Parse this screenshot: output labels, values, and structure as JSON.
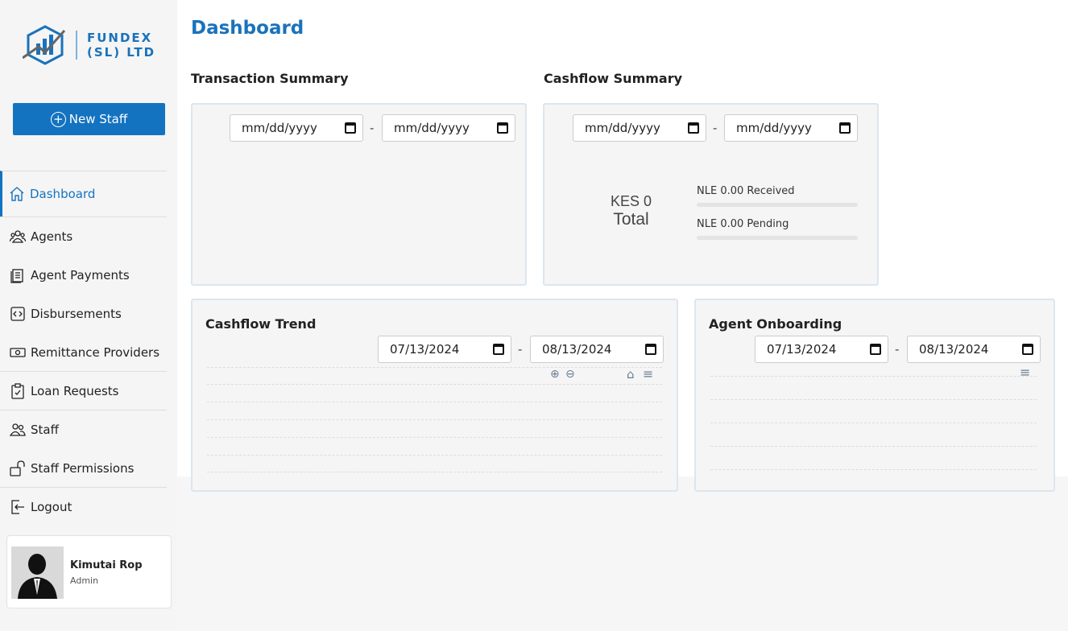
{
  "brand": {
    "name_line1": "FUNDEX",
    "name_line2": "(SL) LTD"
  },
  "sidebar": {
    "new_staff": "New Staff",
    "items": [
      {
        "label": "Dashboard",
        "icon": "home-icon"
      },
      {
        "label": "Agents",
        "icon": "users-icon"
      },
      {
        "label": "Agent Payments",
        "icon": "receipt-icon"
      },
      {
        "label": "Disbursements",
        "icon": "code-icon"
      },
      {
        "label": "Remittance Providers",
        "icon": "cash-icon"
      },
      {
        "label": "Loan Requests",
        "icon": "clipboard-check-icon"
      },
      {
        "label": "Staff",
        "icon": "people-icon"
      },
      {
        "label": "Staff Permissions",
        "icon": "unlock-icon"
      },
      {
        "label": "Logout",
        "icon": "logout-icon"
      }
    ],
    "user": {
      "name": "Kimutai Rop",
      "role": "Admin"
    }
  },
  "page": {
    "title": "Dashboard"
  },
  "transaction_summary": {
    "title": "Transaction Summary",
    "from": "mm/dd/yyyy",
    "to": "mm/dd/yyyy",
    "sep": "-"
  },
  "cashflow_summary": {
    "title": "Cashflow Summary",
    "from": "mm/dd/yyyy",
    "to": "mm/dd/yyyy",
    "sep": "-",
    "total_amount": "KES 0",
    "total_label": "Total",
    "received": "NLE 0.00 Received",
    "pending": "NLE 0.00 Pending",
    "received_fraction": 0,
    "pending_fraction": 0
  },
  "cashflow_trend": {
    "title": "Cashflow Trend",
    "from": "07/13/2024",
    "to": "08/13/2024",
    "sep": "-"
  },
  "agent_onboarding": {
    "title": "Agent Onboarding",
    "from": "07/13/2024",
    "to": "08/13/2024",
    "sep": "-"
  }
}
